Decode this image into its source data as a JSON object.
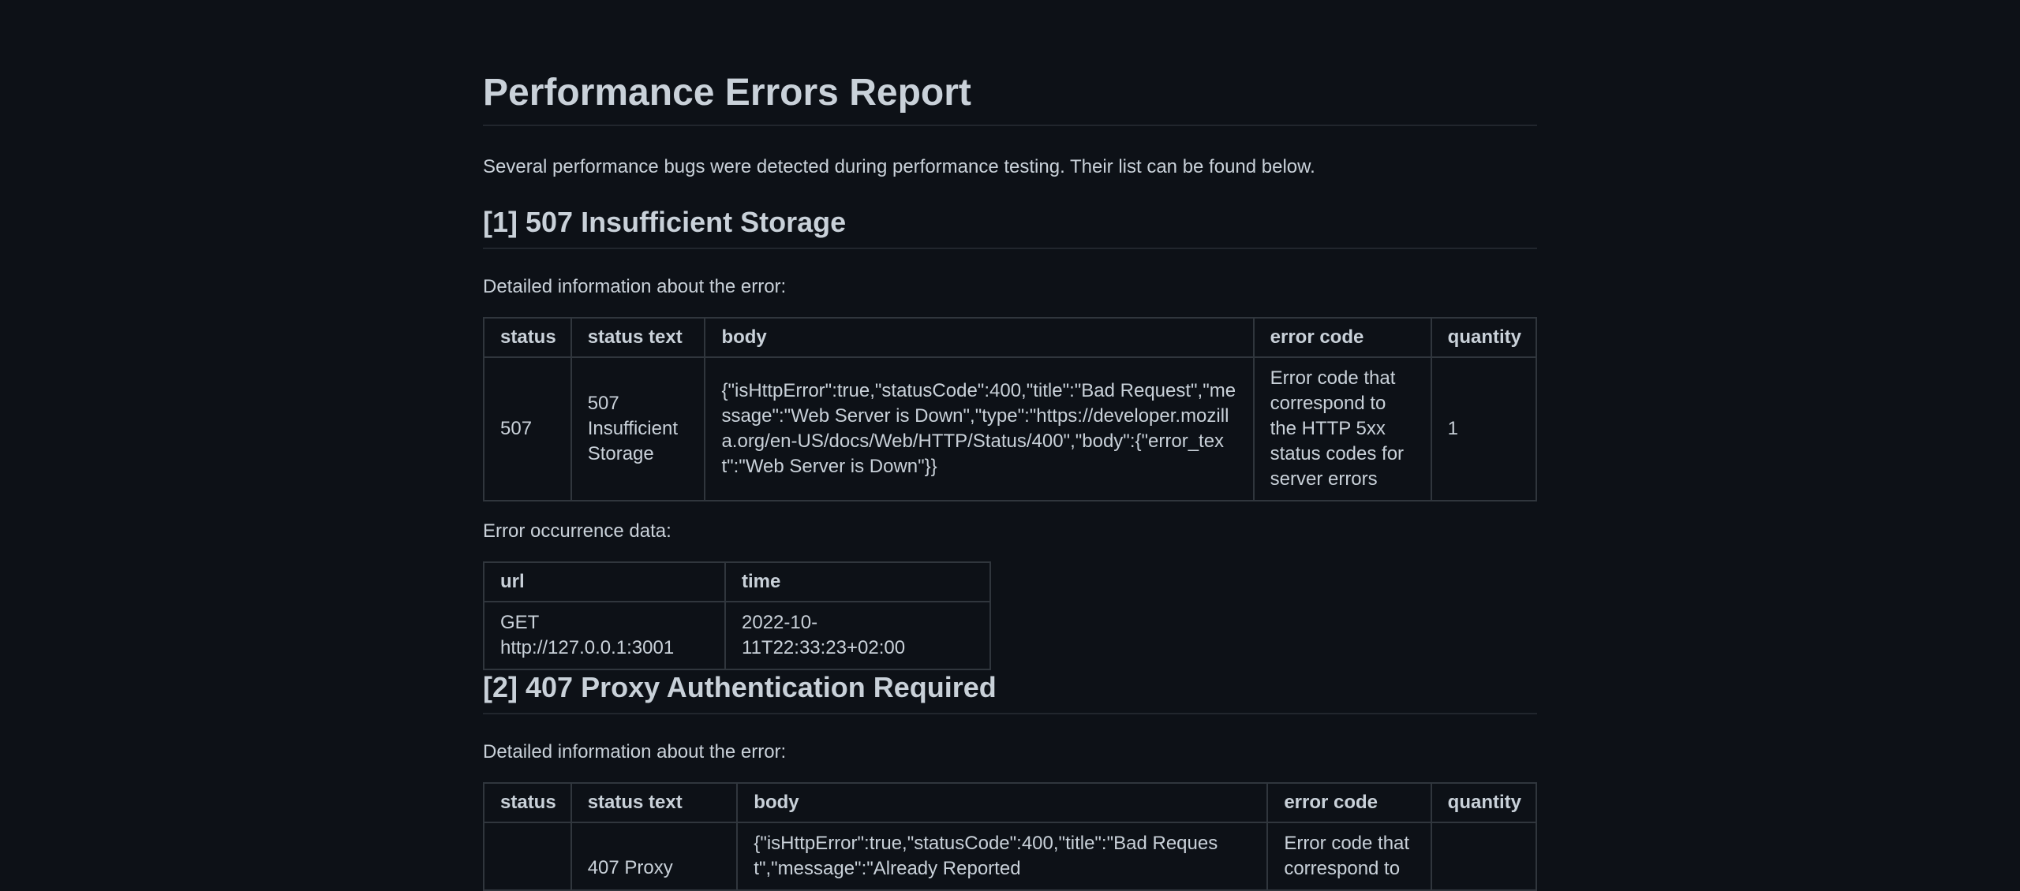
{
  "report": {
    "title": "Performance Errors Report",
    "intro": "Several performance bugs were detected during performance testing. Their list can be found below."
  },
  "errors": [
    {
      "heading": "[1] 507 Insufficient Storage",
      "details_label": "Detailed information about the error:",
      "columns": [
        "status",
        "status text",
        "body",
        "error code",
        "quantity"
      ],
      "row": {
        "status": "507",
        "status_text": "507 Insufficient Storage",
        "body": "{\"isHttpError\":true,\"statusCode\":400,\"title\":\"Bad Request\",\"message\":\"Web Server is Down\",\"type\":\"https://developer.mozilla.org/en-US/docs/Web/HTTP/Status/400\",\"body\":{\"error_text\":\"Web Server is Down\"}}",
        "error_code": "Error code that correspond to the HTTP 5xx status codes for server errors",
        "quantity": "1"
      },
      "occurrence_label": "Error occurrence data:",
      "occurrence_columns": [
        "url",
        "time"
      ],
      "occurrence_row": {
        "url": "GET http://127.0.0.1:3001",
        "time": "2022-10-11T22:33:23+02:00"
      }
    },
    {
      "heading": "[2] 407 Proxy Authentication Required",
      "details_label": "Detailed information about the error:",
      "columns": [
        "status",
        "status text",
        "body",
        "error code",
        "quantity"
      ],
      "row": {
        "status": "",
        "status_text": "407 Proxy",
        "body": "{\"isHttpError\":true,\"statusCode\":400,\"title\":\"Bad Request\",\"message\":\"Already Reported",
        "error_code": "Error code that correspond to",
        "quantity": ""
      }
    }
  ]
}
